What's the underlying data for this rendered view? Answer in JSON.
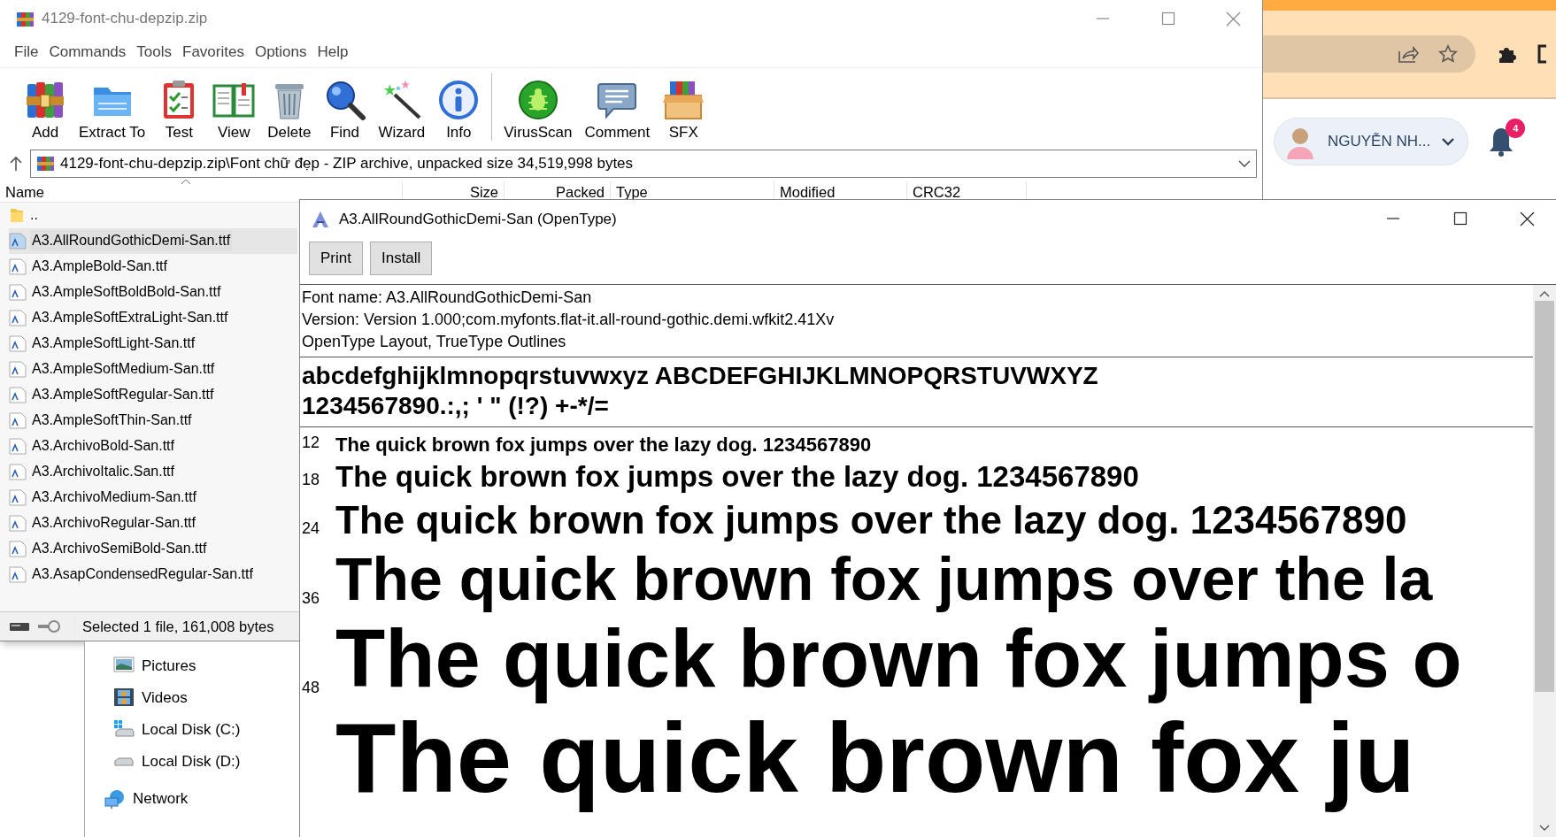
{
  "winrar": {
    "title": "4129-font-chu-depzip.zip",
    "menu": [
      "File",
      "Commands",
      "Tools",
      "Favorites",
      "Options",
      "Help"
    ],
    "toolbar": [
      [
        {
          "label": "Add",
          "kind": "add"
        },
        {
          "label": "Extract To",
          "kind": "extract"
        },
        {
          "label": "Test",
          "kind": "test"
        },
        {
          "label": "View",
          "kind": "view"
        },
        {
          "label": "Delete",
          "kind": "delete"
        },
        {
          "label": "Find",
          "kind": "find"
        },
        {
          "label": "Wizard",
          "kind": "wizard"
        },
        {
          "label": "Info",
          "kind": "info"
        }
      ],
      [
        {
          "label": "VirusScan",
          "kind": "virusscan"
        },
        {
          "label": "Comment",
          "kind": "comment"
        },
        {
          "label": "SFX",
          "kind": "sfx"
        }
      ]
    ],
    "address": "4129-font-chu-depzip.zip\\Font chữ đẹp - ZIP archive, unpacked size 34,519,998 bytes",
    "columns": [
      "Name",
      "Size",
      "Packed",
      "Type",
      "Modified",
      "CRC32"
    ],
    "files": [
      {
        "name": "..",
        "kind": "folder",
        "selected": false
      },
      {
        "name": "A3.AllRoundGothicDemi-San.ttf",
        "kind": "font",
        "selected": true
      },
      {
        "name": "A3.AmpleBold-San.ttf",
        "kind": "font",
        "selected": false
      },
      {
        "name": "A3.AmpleSoftBoldBold-San.ttf",
        "kind": "font",
        "selected": false
      },
      {
        "name": "A3.AmpleSoftExtraLight-San.ttf",
        "kind": "font",
        "selected": false
      },
      {
        "name": "A3.AmpleSoftLight-San.ttf",
        "kind": "font",
        "selected": false
      },
      {
        "name": "A3.AmpleSoftMedium-San.ttf",
        "kind": "font",
        "selected": false
      },
      {
        "name": "A3.AmpleSoftRegular-San.ttf",
        "kind": "font",
        "selected": false
      },
      {
        "name": "A3.AmpleSoftThin-San.ttf",
        "kind": "font",
        "selected": false
      },
      {
        "name": "A3.ArchivoBold-San.ttf",
        "kind": "font",
        "selected": false
      },
      {
        "name": "A3.ArchivoItalic.San.ttf",
        "kind": "font",
        "selected": false
      },
      {
        "name": "A3.ArchivoMedium-San.ttf",
        "kind": "font",
        "selected": false
      },
      {
        "name": "A3.ArchivoRegular-San.ttf",
        "kind": "font",
        "selected": false
      },
      {
        "name": "A3.ArchivoSemiBold-San.ttf",
        "kind": "font",
        "selected": false
      },
      {
        "name": "A3.AsapCondensedRegular-San.ttf",
        "kind": "font",
        "selected": false
      }
    ],
    "status": "Selected 1 file, 161,008 bytes"
  },
  "font_viewer": {
    "title": "A3.AllRoundGothicDemi-San (OpenType)",
    "buttons": [
      "Print",
      "Install"
    ],
    "info": [
      "Font name: A3.AllRoundGothicDemi-San",
      "Version: Version 1.000;com.myfonts.flat-it.all-round-gothic.demi.wfkit2.41Xv",
      "OpenType Layout, TrueType Outlines"
    ],
    "charset": [
      "abcdefghijklmnopqrstuvwxyz ABCDEFGHIJKLMNOPQRSTUVWXYZ",
      "1234567890.:,; ' \" (!?) +-*/="
    ],
    "samples": [
      {
        "size": "12",
        "text": "The quick brown fox jumps over the lazy dog. 1234567890"
      },
      {
        "size": "18",
        "text": "The quick brown fox jumps over the lazy dog. 1234567890"
      },
      {
        "size": "24",
        "text": "The quick brown fox jumps over the lazy dog. 1234567890"
      },
      {
        "size": "36",
        "text": "The quick brown fox jumps over the la"
      },
      {
        "size": "48",
        "text": "The quick brown fox jumps o"
      },
      {
        "text": "The quick brown fox ju"
      }
    ]
  },
  "explorer": {
    "items": [
      {
        "label": "Pictures",
        "kind": "pictures"
      },
      {
        "label": "Videos",
        "kind": "videos"
      },
      {
        "label": "Local Disk (C:)",
        "kind": "system-disk"
      },
      {
        "label": "Local Disk (D:)",
        "kind": "disk"
      },
      {
        "label": "Network",
        "kind": "network"
      }
    ]
  },
  "browser": {
    "user_name": "NGUYỄN NH...",
    "notifications": "4"
  }
}
